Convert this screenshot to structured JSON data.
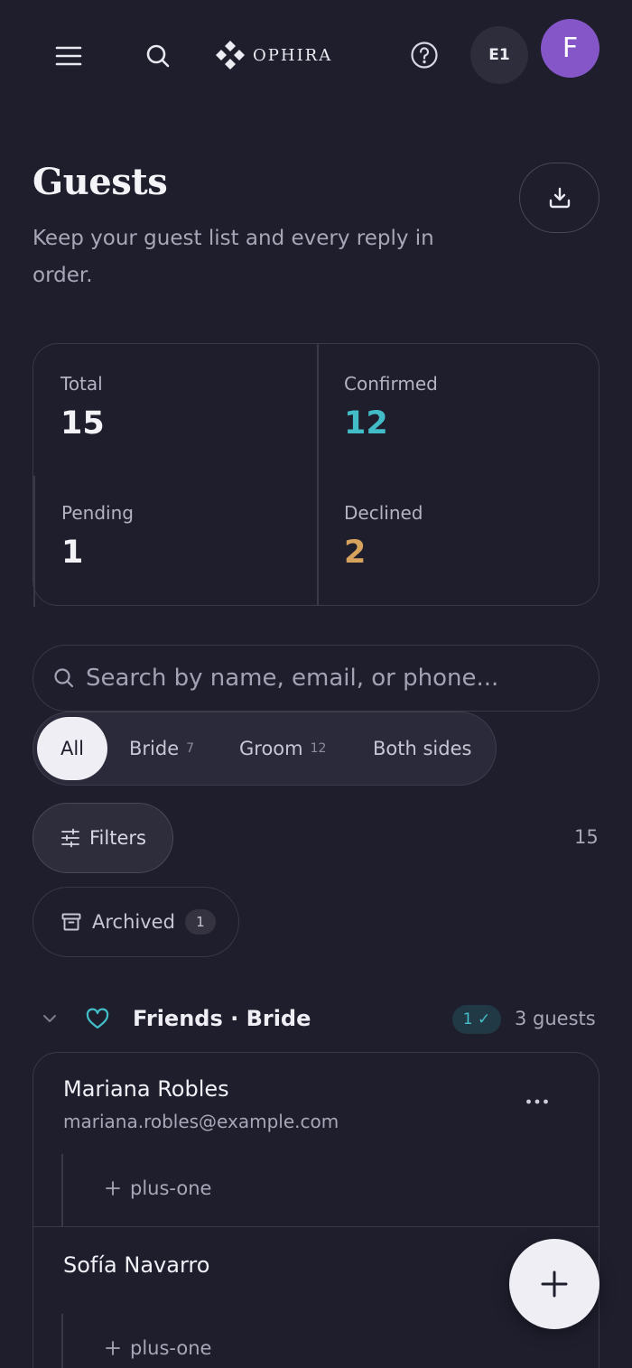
{
  "header": {
    "brand_name": "OPHIRA",
    "event_chip": "E1",
    "avatar_initial": "F"
  },
  "page": {
    "title": "Guests",
    "subtitle": "Keep your guest list and every reply in order."
  },
  "stats": {
    "total": {
      "label": "Total",
      "value": "15"
    },
    "confirmed": {
      "label": "Confirmed",
      "value": "12"
    },
    "pending": {
      "label": "Pending",
      "value": "1"
    },
    "declined": {
      "label": "Declined",
      "value": "2"
    }
  },
  "search": {
    "placeholder": "Search by name, email, or phone..."
  },
  "sides": {
    "all": {
      "label": "All"
    },
    "bride": {
      "label": "Bride",
      "count": "7"
    },
    "groom": {
      "label": "Groom",
      "count": "12"
    },
    "both": {
      "label": "Both sides"
    }
  },
  "filters": {
    "label": "Filters",
    "result_count": "15"
  },
  "archived": {
    "label": "Archived",
    "count": "1"
  },
  "group": {
    "title": "Friends · Bride",
    "confirmed_badge": "1 ✓",
    "guest_count": "3 guests",
    "guests": [
      {
        "name": "Mariana Robles",
        "email": "mariana.robles@example.com",
        "plus_one": "plus-one"
      },
      {
        "name": "Sofía Navarro",
        "plus_one": "plus-one"
      }
    ]
  },
  "colors": {
    "background": "#1e1e2d",
    "accent_teal": "#42bcc7",
    "accent_gold": "#d6a25c",
    "avatar": "#8556c8"
  },
  "icons": {
    "menu": "menu-icon",
    "search": "search-icon",
    "help": "help-circle-icon",
    "download": "download-icon",
    "filters": "sliders-icon",
    "archive": "archive-icon",
    "chevron": "chevron-down-icon",
    "heart": "heart-icon",
    "more": "more-horizontal-icon",
    "plus": "plus-icon"
  }
}
